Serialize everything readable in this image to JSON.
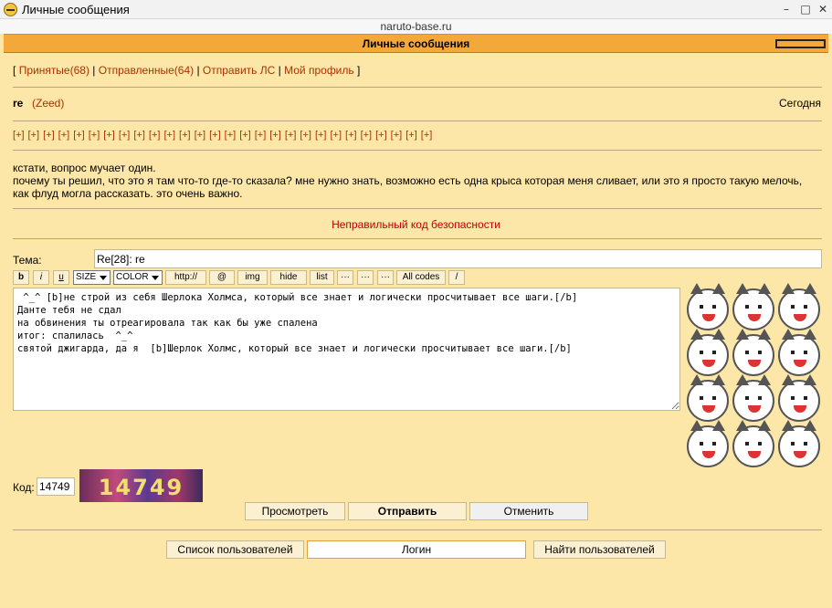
{
  "window": {
    "title": "Личные сообщения",
    "min_icon": "minimize-icon",
    "max_icon": "maximize-icon",
    "close_icon": "close-icon"
  },
  "url": "naruto-base.ru",
  "header": {
    "title": "Личные сообщения"
  },
  "nav": {
    "open": "[",
    "inbox": "Принятые(68)",
    "sep1": "|",
    "sent": "Отправленные(64)",
    "sep2": "|",
    "send": "Отправить ЛС",
    "sep3": "|",
    "profile": "Мой профиль",
    "close": "]"
  },
  "message": {
    "subject": "re",
    "author": "(Zeed)",
    "date": "Сегодня",
    "plus_label": "[+]",
    "plus_count": 28,
    "text_line1": "кстати, вопрос мучает один.",
    "text_line2": "почему ты решил, что это я там что-то где-то сказала? мне нужно знать, возможно есть одна крыса которая меня сливает, или это я просто такую мелочь,",
    "text_line3": "как флуд могла рассказать. это очень важно."
  },
  "error": "Неправильный код безопасности",
  "form": {
    "subject_label": "Тема:",
    "subject_value": "Re[28]: re",
    "toolbar": {
      "b": "b",
      "i": "i",
      "u": "u",
      "size": "SIZE",
      "color": "COLOR",
      "http": "http://",
      "at": "@",
      "img": "img",
      "hide": "hide",
      "list": "list",
      "dots1": "···",
      "dots2": "···",
      "dots3": "···",
      "allcodes": "All codes",
      "slash": "/"
    },
    "editor_text": " ^_^ [b]не строй из себя Шерлока Холмса, который все знает и логически просчитывает все шаги.[/b]\nДанте тебя не сдал\nна обвинения ты отреагировала так как бы уже спалена\nитог: спалилась  ^_^\nсвятой джигарда, да я  [b]Шерлок Холмс, который все знает и логически просчитывает все шаги.[/b]",
    "kod_label": "Код:",
    "kod_value": "14749",
    "captcha_text": "14749",
    "preview_btn": "Просмотреть",
    "send_btn": "Отправить",
    "cancel_btn": "Отменить"
  },
  "bottom": {
    "users_btn": "Список пользователей",
    "login_btn": "Логин",
    "find_btn": "Найти пользователей"
  },
  "colors": {
    "background": "#fce7a8",
    "header": "#f5a83a",
    "link": "#a83200",
    "error": "#c00000"
  }
}
